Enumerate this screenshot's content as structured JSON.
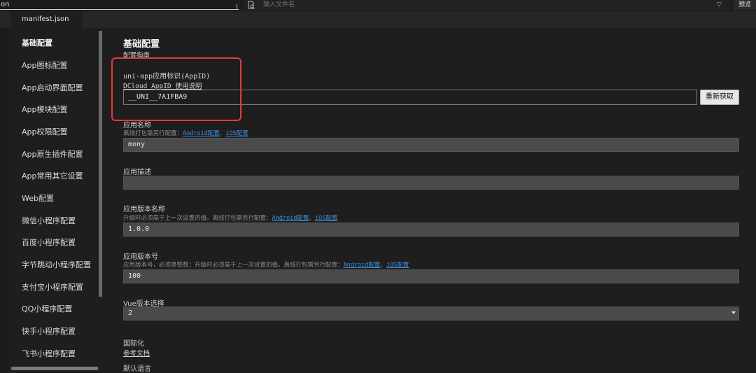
{
  "topbar": {
    "left_input_value": "on",
    "search_placeholder": "输入文件名",
    "filter_icon": "filter-icon",
    "preview_label": "预览"
  },
  "tab": {
    "label": "manifest.json"
  },
  "sidebar": {
    "items": [
      {
        "label": "基础配置",
        "active": true
      },
      {
        "label": "App图标配置"
      },
      {
        "label": "App启动界面配置"
      },
      {
        "label": "App模块配置"
      },
      {
        "label": "App权限配置"
      },
      {
        "label": "App原生插件配置"
      },
      {
        "label": "App常用其它设置"
      },
      {
        "label": "Web配置"
      },
      {
        "label": "微信小程序配置"
      },
      {
        "label": "百度小程序配置"
      },
      {
        "label": "字节跳动小程序配置"
      },
      {
        "label": "支付宝小程序配置"
      },
      {
        "label": "QQ小程序配置"
      },
      {
        "label": "快手小程序配置"
      },
      {
        "label": "飞书小程序配置"
      }
    ]
  },
  "main": {
    "title": "基础配置",
    "guide_link": "配置指南",
    "appid": {
      "label": "uni-app应用标识(AppID)",
      "help_link": "DCloud AppID 使用说明",
      "value": "__UNI__7A1FBA9",
      "button": "重新获取"
    },
    "app_name": {
      "label": "应用名称",
      "hint_prefix": "离线打包需另行配置：",
      "android_link": "Android配置",
      "sep": "、",
      "ios_link": "iOS配置",
      "value": "mony"
    },
    "app_desc": {
      "label": "应用描述",
      "value": ""
    },
    "version_name": {
      "label": "应用版本名称",
      "hint_prefix": "升级时必须高于上一次设置的值。离线打包需另行配置：",
      "android_link": "Android配置",
      "sep": "、",
      "ios_link": "iOS配置",
      "value": "1.0.0"
    },
    "version_code": {
      "label": "应用版本号",
      "hint_prefix": "应用版本号，必须是整数；升级时必须高于上一次设置的值。离线打包需另行配置：",
      "android_link": "Android配置",
      "sep": "、",
      "ios_link": "iOS配置",
      "value": "100"
    },
    "vue_version": {
      "label": "Vue版本选择",
      "value": "2"
    },
    "i18n": {
      "label": "国际化",
      "doc_link": "参考文档"
    },
    "default_lang": {
      "label": "默认语言"
    }
  },
  "colors": {
    "highlight": "#e33a3a",
    "link": "#3f8fe0"
  }
}
